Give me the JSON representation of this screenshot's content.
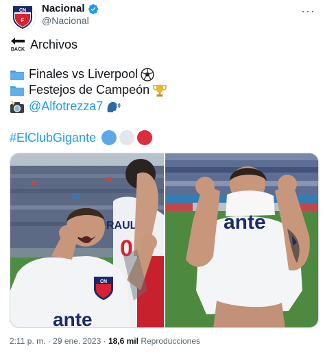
{
  "author": {
    "display_name": "Nacional",
    "handle": "@Nacional",
    "verified": true,
    "avatar_text": "CN",
    "avatar_subtext": "F",
    "more_glyph": "···"
  },
  "tweet": {
    "back_label": "BACK",
    "line1": "Archivos",
    "line2": "Finales vs Liverpool",
    "line3": "Festejos de Campeón",
    "line4_mention": "@Alfotrezza7",
    "line5_hashtag": "#ElClubGigante",
    "icons": {
      "back": "back-arrow-icon",
      "folder": "folder-icon",
      "soccer": "soccer-ball-icon",
      "trophy": "trophy-icon",
      "camera": "camera-flash-icon",
      "speaking": "speaking-head-icon"
    },
    "circles": [
      "#5fa8e8",
      "#e3e6ea",
      "#dd2c3b"
    ]
  },
  "media": {
    "photo1": {
      "shirt_text": "ante",
      "shirt_sponsor": "RAULT",
      "number": "0",
      "badge": "CN"
    },
    "photo2": {
      "shirt_text": "ante"
    }
  },
  "meta": {
    "time": "2:11 p. m.",
    "separator": "·",
    "date": "29 ene. 2023",
    "views_count": "18,6 mil",
    "views_label": "Reproducciones"
  },
  "colors": {
    "link": "#1d9bf0",
    "text": "#0f1419",
    "secondary": "#536471"
  }
}
